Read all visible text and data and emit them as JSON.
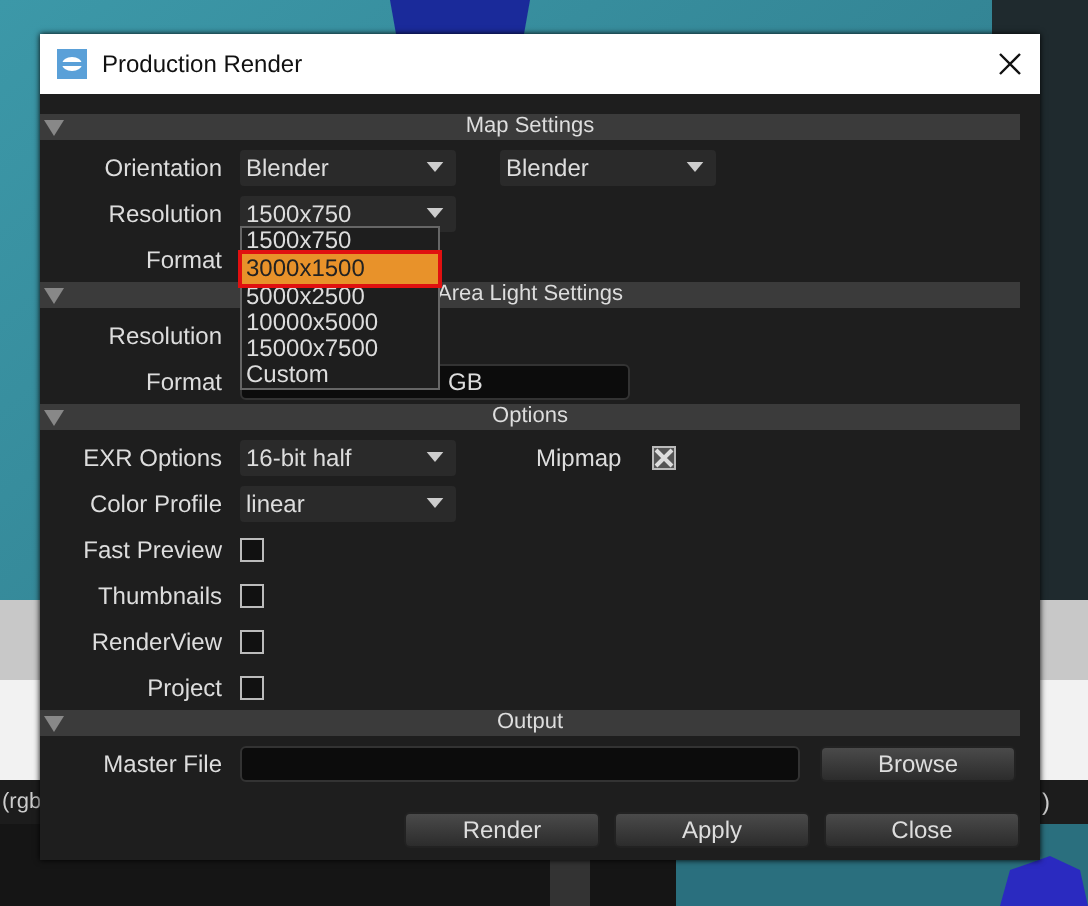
{
  "window": {
    "title": "Production Render"
  },
  "sections": [
    {
      "title": "Map Settings",
      "expanded": true,
      "rows": [
        {
          "kind": "combo",
          "label": "Orientation",
          "values": [
            "Blender",
            "Blender"
          ]
        },
        {
          "kind": "combo",
          "label": "Resolution",
          "values": [
            "1500x750"
          ]
        },
        {
          "kind": "label",
          "label": "Format"
        }
      ]
    },
    {
      "title": "Area Light Settings",
      "expanded": true,
      "rows": [
        {
          "kind": "label",
          "label": "Resolution"
        },
        {
          "kind": "field",
          "label": "Format",
          "value": "GB"
        }
      ]
    },
    {
      "title": "Options",
      "expanded": true,
      "rows": [
        {
          "kind": "combo",
          "label": "EXR Options",
          "values": [
            "16-bit half"
          ],
          "check": {
            "label": "Mipmap",
            "checked": true
          }
        },
        {
          "kind": "combo",
          "label": "Color Profile",
          "values": [
            "linear"
          ]
        },
        {
          "kind": "check",
          "label": "Fast Preview",
          "checked": false
        },
        {
          "kind": "check",
          "label": "Thumbnails",
          "checked": false
        },
        {
          "kind": "check",
          "label": "RenderView",
          "checked": false
        },
        {
          "kind": "check",
          "label": "Project",
          "checked": false
        }
      ]
    },
    {
      "title": "Output",
      "expanded": true,
      "rows": [
        {
          "kind": "file",
          "label": "Master File",
          "button": "Browse"
        }
      ]
    }
  ],
  "dropdown": {
    "options": [
      {
        "label": "1500x750",
        "selected": false
      },
      {
        "label": "3000x1500",
        "selected": true
      },
      {
        "label": "5000x2500",
        "selected": false
      },
      {
        "label": "10000x5000",
        "selected": false
      },
      {
        "label": "15000x7500",
        "selected": false
      },
      {
        "label": "Custom",
        "selected": false
      }
    ]
  },
  "buttons": [
    "Render",
    "Apply",
    "Close"
  ],
  "background": {
    "status_left": "(rgb",
    "status_right": ")"
  }
}
